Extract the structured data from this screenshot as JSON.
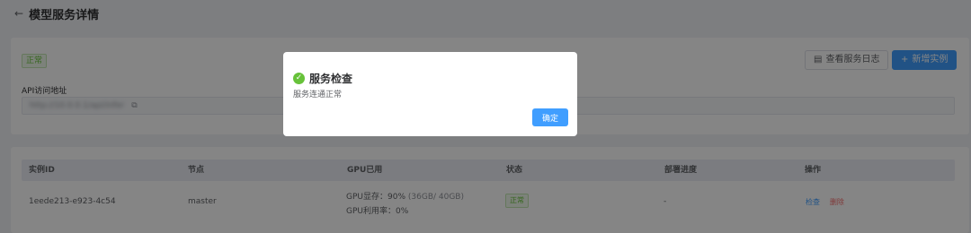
{
  "header": {
    "back_icon": "←",
    "title": "模型服务详情"
  },
  "service": {
    "status": "正常",
    "log_button": "查看服务日志",
    "add_button": "新增实例",
    "api_label": "API访问地址",
    "api_url": "http://10.0.0.1/api/infer"
  },
  "table": {
    "headers": [
      "实例ID",
      "节点",
      "GPU已用",
      "状态",
      "部署进度",
      "操作"
    ],
    "rows": [
      {
        "id": "1eede213-e923-4c54",
        "node": "master",
        "gpu_mem_label": "GPU显存：90%",
        "gpu_mem_detail": "(36GB/ 40GB)",
        "gpu_util": "GPU利用率：0%",
        "status": "正常",
        "progress": "-",
        "action_check": "检查",
        "action_delete": "删除"
      }
    ]
  },
  "dialog": {
    "title": "服务检查",
    "message": "服务连通正常",
    "confirm": "确定"
  },
  "colors": {
    "primary": "#409eff",
    "success": "#67c23a",
    "danger": "#f56c6c"
  }
}
